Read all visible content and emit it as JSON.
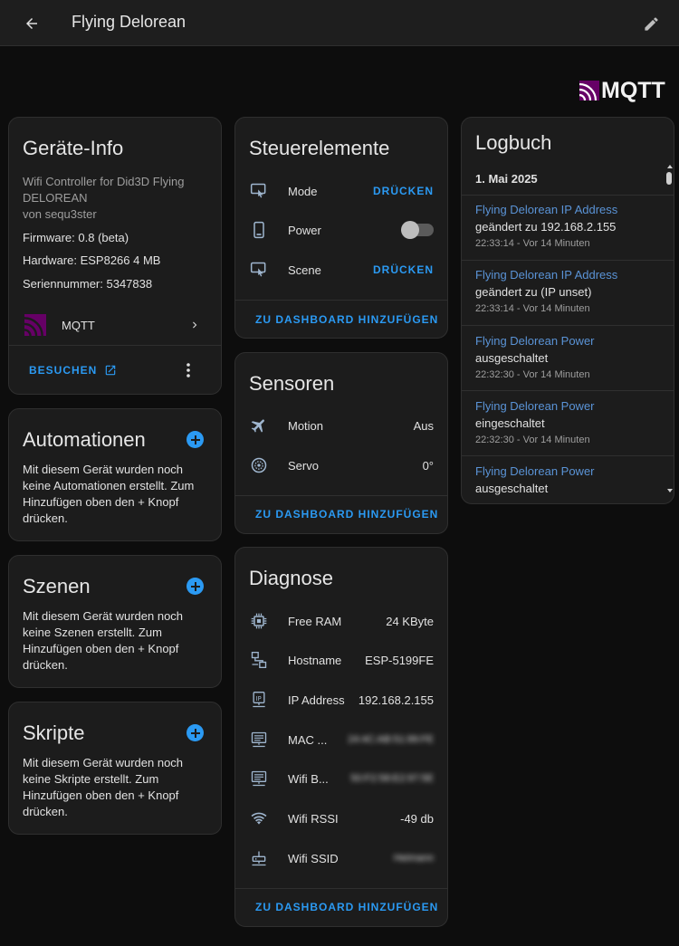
{
  "header": {
    "title": "Flying Delorean"
  },
  "logo": {
    "text": "MQTT"
  },
  "device_info": {
    "title": "Geräte-Info",
    "description_line1": "Wifi Controller for Did3D Flying",
    "description_line2": "DELOREAN",
    "by": "von sequ3ster",
    "firmware": "Firmware: 0.8 (beta)",
    "hardware": "Hardware: ESP8266 4 MB",
    "serial": "Seriennummer: 5347838",
    "integration": "MQTT",
    "visit": "BESUCHEN"
  },
  "automations": {
    "title": "Automationen",
    "text": "Mit diesem Gerät wurden noch keine Automationen erstellt. Zum Hinzufügen oben den + Knopf drücken."
  },
  "scenes": {
    "title": "Szenen",
    "text": "Mit diesem Gerät wurden noch keine Szenen erstellt. Zum Hinzufügen oben den + Knopf drücken."
  },
  "scripts": {
    "title": "Skripte",
    "text": "Mit diesem Gerät wurden noch keine Skripte erstellt. Zum Hinzufügen oben den + Knopf drücken."
  },
  "controls": {
    "title": "Steuerelemente",
    "items": [
      {
        "label": "Mode",
        "action": "DRÜCKEN"
      },
      {
        "label": "Power",
        "state": "off"
      },
      {
        "label": "Scene",
        "action": "DRÜCKEN"
      }
    ],
    "add": "ZU DASHBOARD HINZUFÜGEN"
  },
  "sensors": {
    "title": "Sensoren",
    "items": [
      {
        "label": "Motion",
        "value": "Aus"
      },
      {
        "label": "Servo",
        "value": "0°"
      }
    ],
    "add": "ZU DASHBOARD HINZUFÜGEN"
  },
  "diagnostics": {
    "title": "Diagnose",
    "items": [
      {
        "label": "Free RAM",
        "value": "24 KByte"
      },
      {
        "label": "Hostname",
        "value": "ESP-5199FE"
      },
      {
        "label": "IP Address",
        "value": "192.168.2.155"
      },
      {
        "label": "MAC ...",
        "value": "24:4C:AB:51:99:FE"
      },
      {
        "label": "Wifi B...",
        "value": "50:F2:58:E2:97:5E"
      },
      {
        "label": "Wifi RSSI",
        "value": "-49 db"
      },
      {
        "label": "Wifi SSID",
        "value": "Heimann"
      }
    ],
    "add": "ZU DASHBOARD HINZUFÜGEN"
  },
  "logbook": {
    "title": "Logbuch",
    "date": "1. Mai 2025",
    "entries": [
      {
        "who": "Flying Delorean IP Address",
        "what": "geändert zu 192.168.2.155",
        "when": "22:33:14 - Vor 14 Minuten"
      },
      {
        "who": "Flying Delorean IP Address",
        "what": "geändert zu (IP unset)",
        "when": "22:33:14 - Vor 14 Minuten"
      },
      {
        "who": "Flying Delorean Power",
        "what": "ausgeschaltet",
        "when": "22:32:30 - Vor 14 Minuten"
      },
      {
        "who": "Flying Delorean Power",
        "what": "eingeschaltet",
        "when": "22:32:30 - Vor 14 Minuten"
      },
      {
        "who": "Flying Delorean Power",
        "what": "ausgeschaltet",
        "when": ""
      }
    ]
  },
  "colors": {
    "accent": "#2b9af3",
    "card": "#1c1c1c",
    "bg": "#0d0d0d",
    "mqtt": "#660066"
  }
}
